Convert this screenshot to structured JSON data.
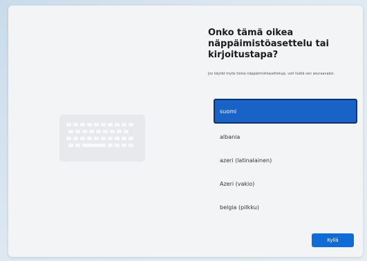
{
  "colors": {
    "accent": "#1a63c6",
    "button": "#0f6cd6",
    "background": "#f3f4f6"
  },
  "icons": {
    "keyboard": "keyboard-icon"
  },
  "dialog": {
    "title": "Onko tämä oikea näppäimistöasettelu tai kirjoitustapa?",
    "subtitle": "Jos käytät myös toisia näppäimistöasetteluja, voit lisätä sen seuraavaksi.",
    "layouts": [
      {
        "label": "suomi",
        "selected": true
      },
      {
        "label": "albania",
        "selected": false
      },
      {
        "label": "azeri (latinalainen)",
        "selected": false
      },
      {
        "label": "Azeri (vakio)",
        "selected": false
      },
      {
        "label": "belgia (pilkku)",
        "selected": false
      }
    ],
    "confirm_label": "Kyllä"
  }
}
